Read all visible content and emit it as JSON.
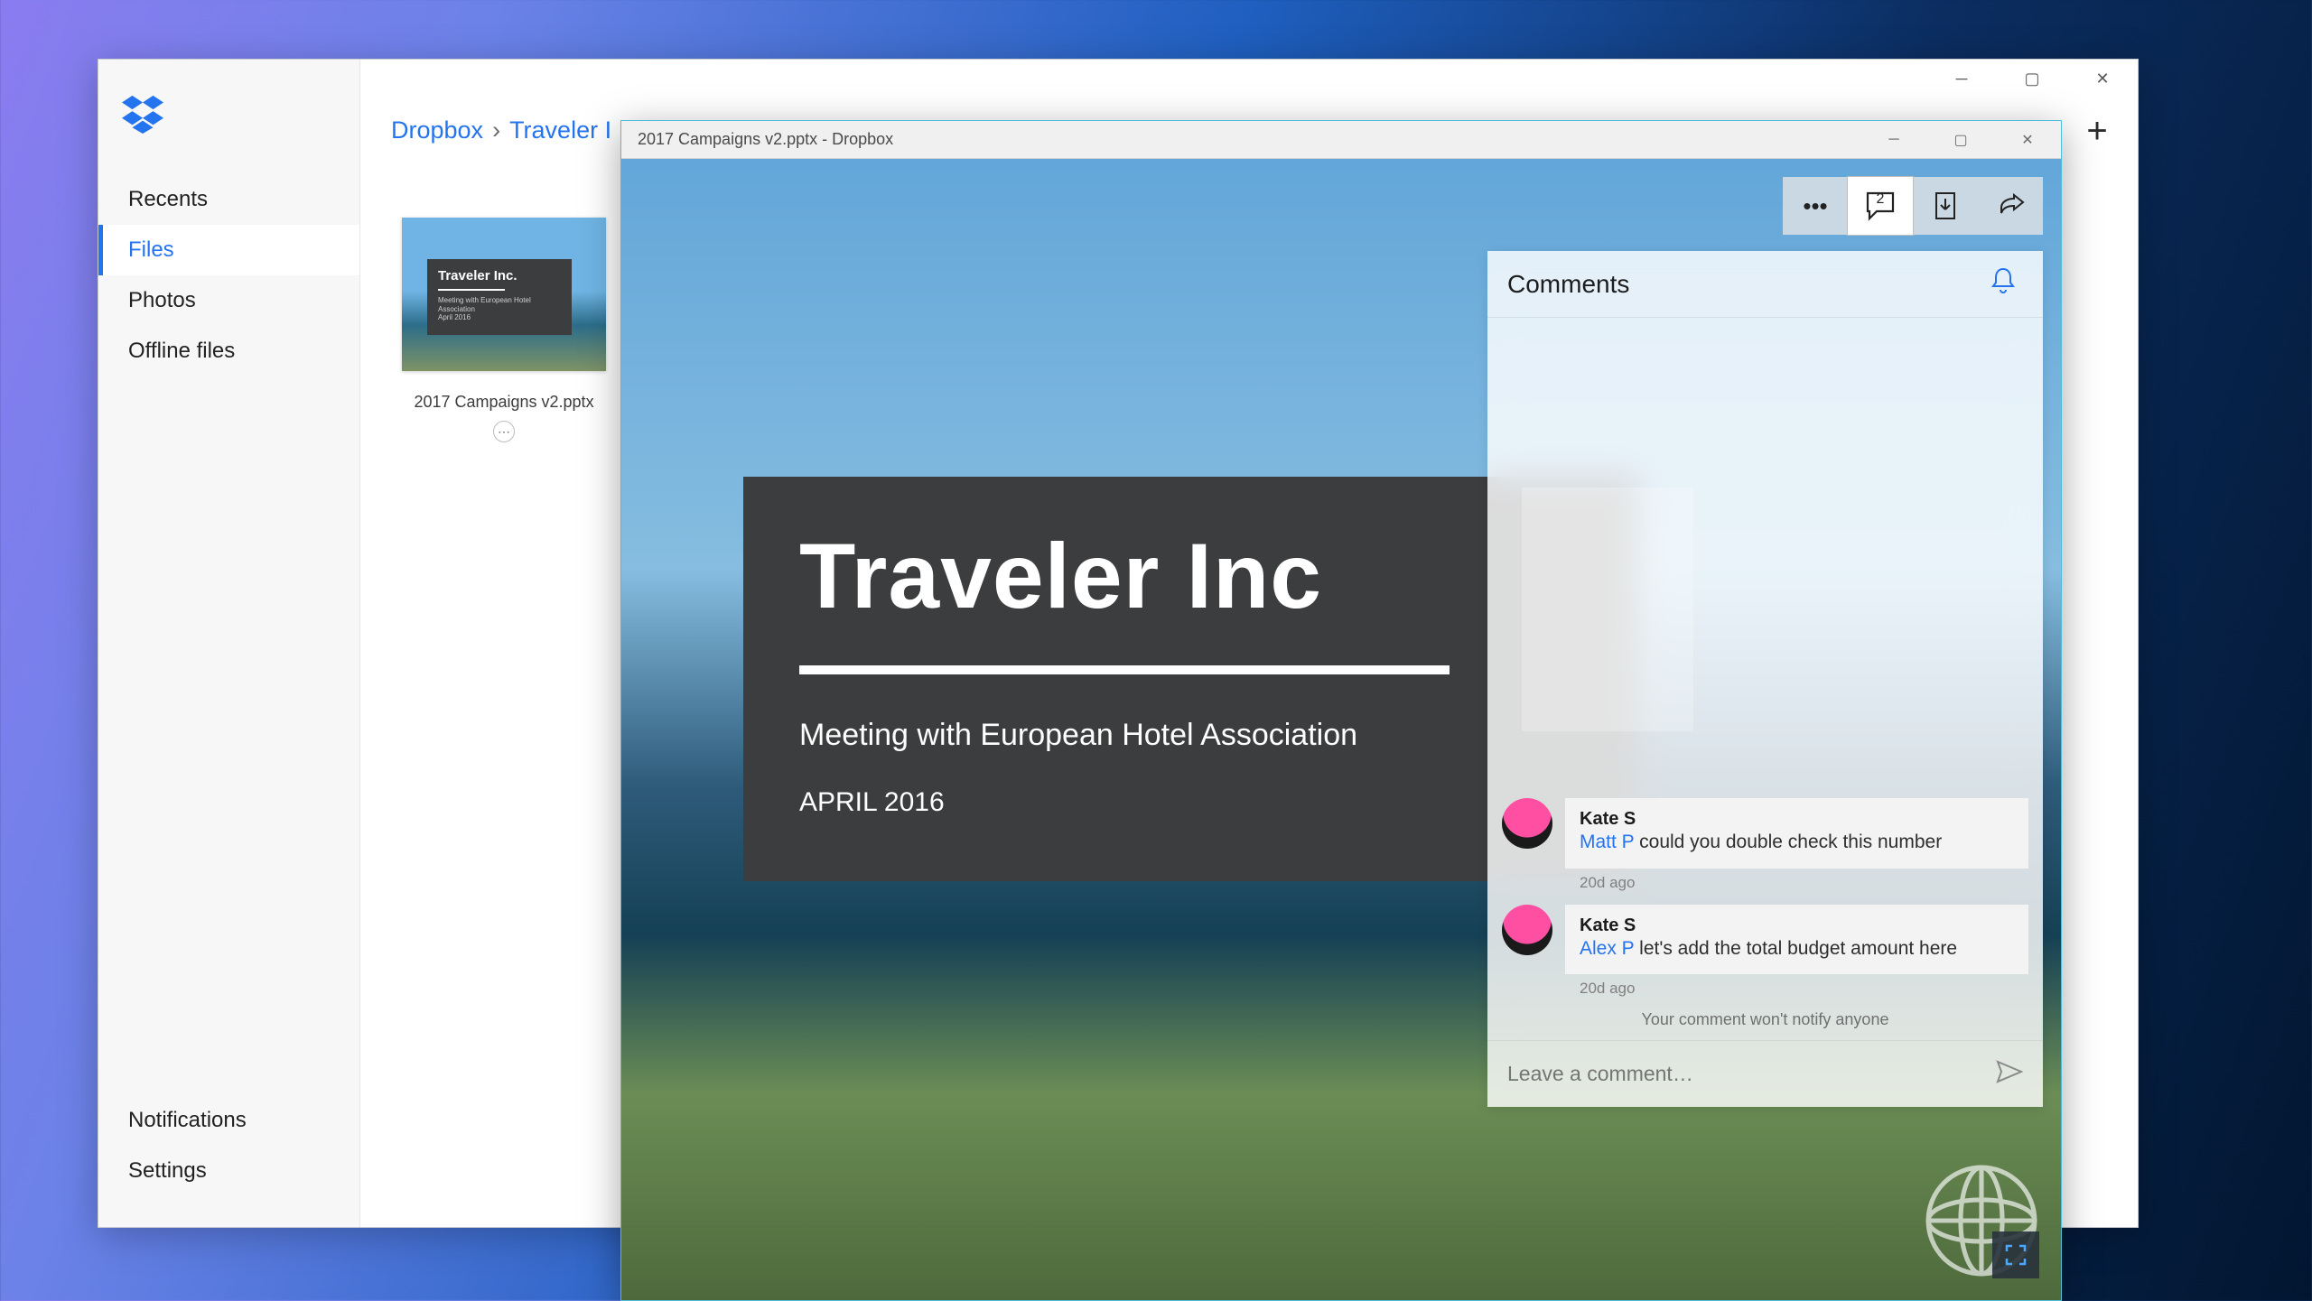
{
  "app_window": {
    "breadcrumb": {
      "root": "Dropbox",
      "next": "Traveler I"
    },
    "sidebar": {
      "items": [
        "Recents",
        "Files",
        "Photos",
        "Offline files"
      ],
      "bottom": [
        "Notifications",
        "Settings"
      ],
      "active_index": 1
    },
    "file": {
      "name": "2017 Campaigns v2.pptx",
      "thumb_title": "Traveler Inc.",
      "thumb_subtitle": "Meeting with European Hotel Association",
      "thumb_date": "April 2016"
    }
  },
  "preview_window": {
    "title": "2017 Campaigns v2.pptx - Dropbox",
    "comment_count": "2",
    "slide": {
      "title": "Traveler Inc",
      "subtitle": "Meeting with European Hotel Association",
      "date": "APRIL 2016"
    },
    "comments": {
      "header": "Comments",
      "thread": [
        {
          "author": "Kate S",
          "mention": "Matt P",
          "body": " could you double check this number",
          "time": "20d ago"
        },
        {
          "author": "Kate S",
          "mention": "Alex P",
          "body": " let's add the total budget amount here",
          "time": "20d ago"
        }
      ],
      "notify_note": "Your comment won't notify anyone",
      "input_placeholder": "Leave a comment…"
    }
  }
}
